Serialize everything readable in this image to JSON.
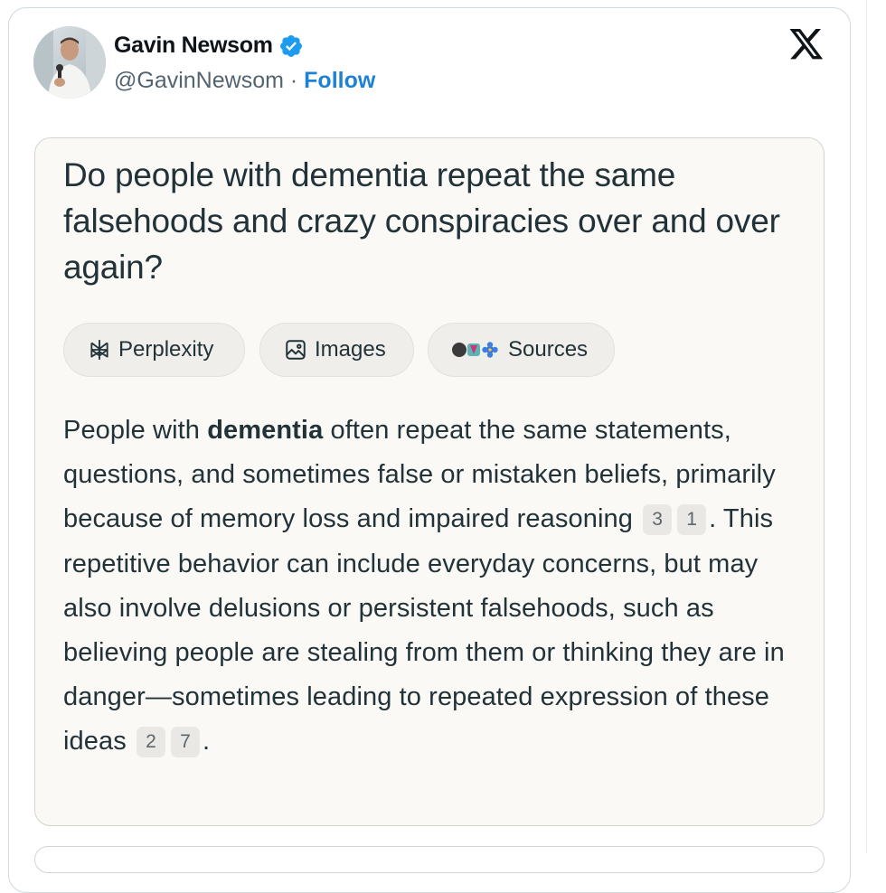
{
  "tweet": {
    "author_name": "Gavin Newsom",
    "handle": "@GavinNewsom",
    "separator": " · ",
    "follow_label": "Follow",
    "verified_icon": "verified-badge-icon",
    "platform_icon": "x-logo-icon"
  },
  "answer_card": {
    "question": "Do people with dementia repeat the same falsehoods and crazy conspiracies over and over again?",
    "chips": [
      {
        "label": "Perplexity",
        "icon": "perplexity-icon"
      },
      {
        "label": "Images",
        "icon": "image-icon"
      },
      {
        "label": "Sources",
        "icon": "source-favicons-icon"
      }
    ],
    "answer": {
      "part1": "People with ",
      "bold": "dementia",
      "part2": " often repeat the same statements, questions, and sometimes false or mistaken beliefs, primarily because of memory loss and impaired reasoning",
      "cite1": "3",
      "cite2": "1",
      "part3": ". This repetitive behavior can include everyday concerns, but may also involve delusions or persistent falsehoods, such as believing people are stealing from them or thinking they are in danger—sometimes leading to repeated expression of these ideas",
      "cite3": "2",
      "cite4": "7",
      "part4": "."
    }
  },
  "colors": {
    "follow": "#1d82d6",
    "verified": "#1d9bf0",
    "card_bg": "#faf9f6",
    "text": "#213238"
  }
}
